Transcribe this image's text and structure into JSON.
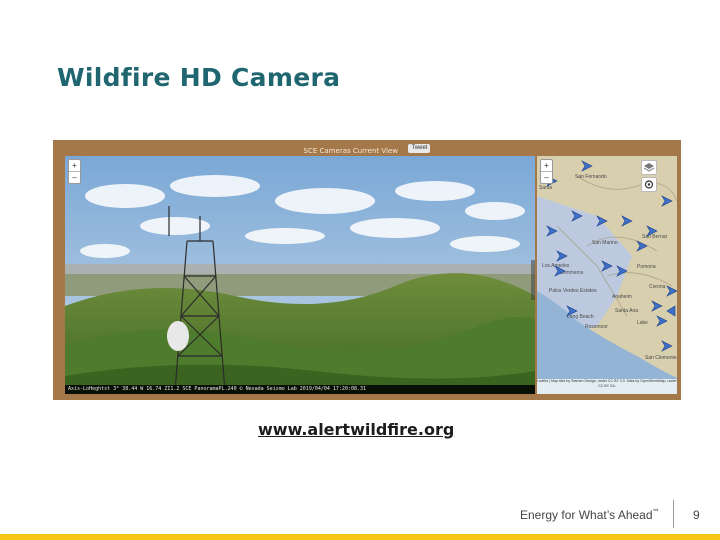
{
  "slide": {
    "title": "Wildfire HD Camera",
    "link_text": "www.alertwildfire.org",
    "footer_tagline": "Energy for What’s Ahead",
    "footer_tagline_mark": "℠",
    "page_number": "9"
  },
  "viewer": {
    "header_title": "SCE Cameras Current View",
    "tweet_label": "Tweet",
    "camera": {
      "zoom_in": "+",
      "zoom_out": "–",
      "status_line": "Axis-LoHeghtst 3° 38.44 W 16.74 ZI1.2 SCE PanoramaPL.240 © Nevada Seismo Lab 2019/04/04 17:20:08.31"
    },
    "map": {
      "zoom_in": "+",
      "zoom_out": "–",
      "place_labels": [
        "San Fernando",
        "Santa",
        "San Marino",
        "San Bernar",
        "Los Angeles",
        "Commerce",
        "Pomona",
        "Palos Verdes Estates",
        "Anaheim",
        "Corona",
        "Long Beach",
        "Santa Ana",
        "Rossmoor",
        "San Clemente",
        "Lake"
      ],
      "attribution": "Leaflet | Map tiles by Stamen Design, under CC BY 3.0. Data by OpenStreetMap, under CC BY SA."
    }
  },
  "colors": {
    "title": "#1f6670",
    "frame": "#a5784a",
    "accent_bar": "#f5c518",
    "camera_marker": "#3e6fc9"
  }
}
